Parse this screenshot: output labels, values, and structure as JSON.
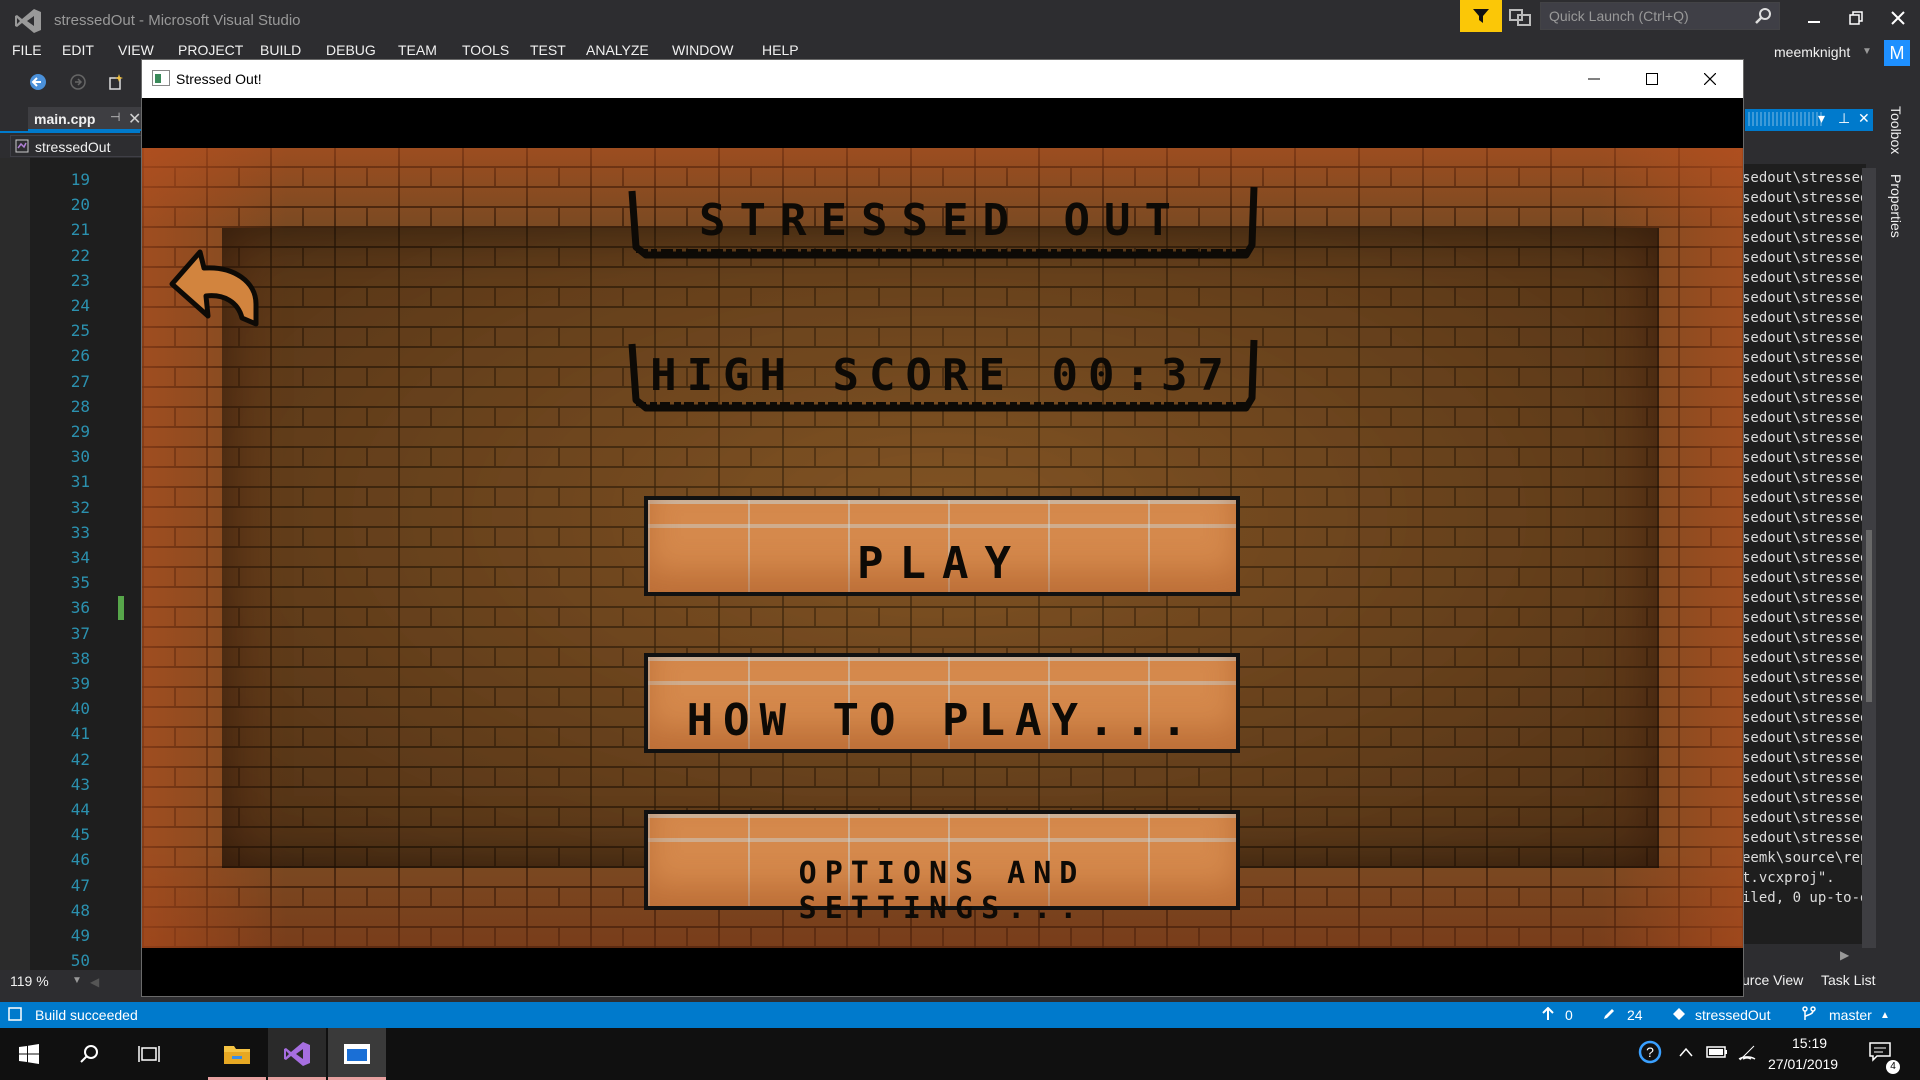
{
  "vs": {
    "window_title": "stressedOut - Microsoft Visual Studio",
    "quick_launch_placeholder": "Quick Launch (Ctrl+Q)",
    "user_name": "meemknight",
    "user_initial": "M",
    "menu": [
      "FILE",
      "EDIT",
      "VIEW",
      "PROJECT",
      "BUILD",
      "DEBUG",
      "TEAM",
      "TOOLS",
      "TEST",
      "ANALYZE",
      "WINDOW",
      "HELP"
    ],
    "tab": {
      "label": "main.cpp"
    },
    "nav_scope": "stressedOut",
    "line_numbers": [
      "19",
      "20",
      "21",
      "22",
      "23",
      "24",
      "25",
      "26",
      "27",
      "28",
      "29",
      "30",
      "31",
      "32",
      "33",
      "34",
      "35",
      "36",
      "37",
      "38",
      "39",
      "40",
      "41",
      "42",
      "43",
      "44",
      "45",
      "46",
      "47",
      "48",
      "49",
      "50"
    ],
    "zoom": "119 %",
    "output_lines": [
      "sedout\\stressed",
      "sedout\\stressed",
      "sedout\\stressed",
      "sedout\\stressed",
      "sedout\\stressed",
      "sedout\\stressed",
      "sedout\\stressed",
      "sedout\\stressed",
      "sedout\\stressed",
      "sedout\\stressed",
      "sedout\\stressed",
      "sedout\\stressed",
      "sedout\\stressed",
      "sedout\\stressed",
      "sedout\\stressed",
      "sedout\\stressed",
      "sedout\\stressed",
      "sedout\\stressed",
      "sedout\\stressed",
      "sedout\\stressed",
      "sedout\\stressed",
      "sedout\\stressed",
      "sedout\\stressed",
      "sedout\\stressed",
      "sedout\\stressed",
      "sedout\\stressed",
      "sedout\\stressed",
      "sedout\\stressed",
      "sedout\\stressed",
      "sedout\\stressed",
      "sedout\\stressed",
      "sedout\\stressed",
      "sedout\\stressed",
      "sedout\\stressed",
      "eemk\\source\\rep",
      "t.vcxproj\".",
      "iled, 0 up-to-d"
    ],
    "bottom_tabs": [
      "urce View",
      "Task List"
    ],
    "side_labels": [
      "Toolbox",
      "Properties"
    ],
    "status": {
      "message": "Build succeeded",
      "push_count": "0",
      "changes_count": "24",
      "repo": "stressedOut",
      "branch": "master"
    }
  },
  "taskbar": {
    "time": "15:19",
    "date": "27/01/2019",
    "notification_count": "4"
  },
  "game": {
    "window_title": "Stressed Out!",
    "title_sign": "STRESSED OUT",
    "high_score_sign": "HIGH SCORE 00:37",
    "buttons": [
      "PLAY",
      "HOW TO PLAY...",
      "OPTIONS AND SETTINGS..."
    ]
  },
  "colors": {
    "vs_accent": "#007acc",
    "filter_yellow": "#fbc707",
    "brick": "#7a4a22",
    "button_brick": "#d5894c"
  }
}
